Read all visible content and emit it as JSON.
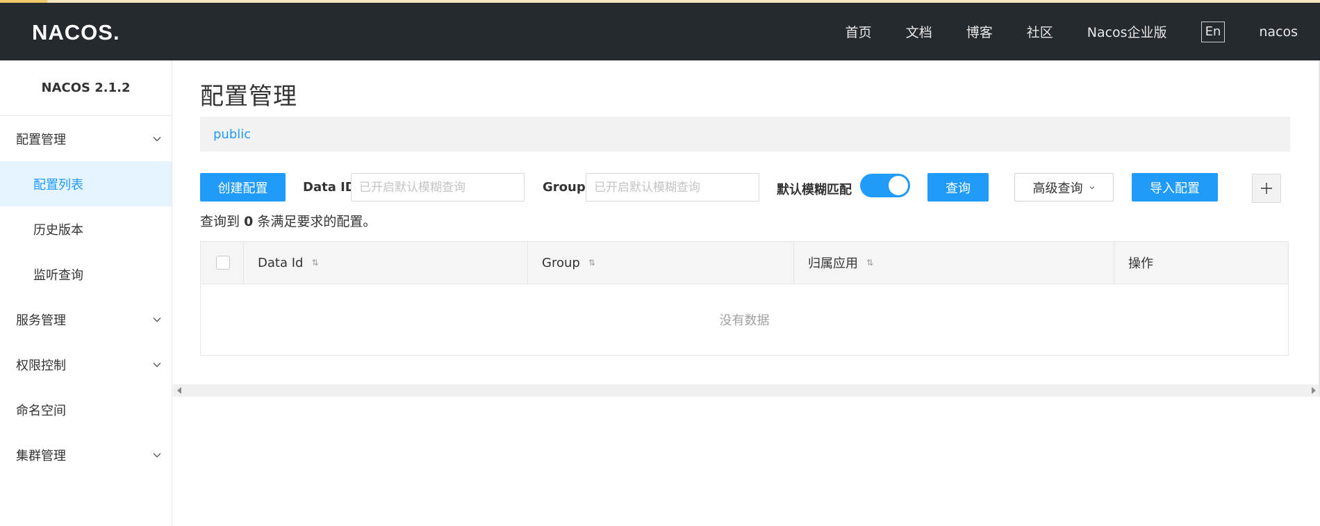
{
  "header": {
    "logo_text": "NACOS.",
    "nav": [
      "首页",
      "文档",
      "博客",
      "社区",
      "Nacos企业版"
    ],
    "lang": "En",
    "user": "nacos"
  },
  "sidebar": {
    "title": "NACOS 2.1.2",
    "groups": [
      {
        "label": "配置管理",
        "items": [
          "配置列表",
          "历史版本",
          "监听查询"
        ]
      },
      {
        "label": "服务管理"
      },
      {
        "label": "权限控制"
      },
      {
        "label": "命名空间"
      },
      {
        "label": "集群管理"
      }
    ]
  },
  "main": {
    "title": "配置管理",
    "namespace": "public",
    "toolbar": {
      "create_label": "创建配置",
      "data_id_label": "Data ID",
      "data_id_placeholder": "已开启默认模糊查询",
      "group_label": "Group",
      "group_placeholder": "已开启默认模糊查询",
      "fuzzy_label": "默认模糊匹配",
      "fuzzy_on": true,
      "query_label": "查询",
      "advanced_label": "高级查询",
      "import_label": "导入配置",
      "plus_label": "+"
    },
    "result": {
      "prefix": "查询到",
      "count": "0",
      "suffix": "条满足要求的配置。"
    },
    "table": {
      "columns": [
        "Data Id",
        "Group",
        "归属应用",
        "操作"
      ],
      "empty_text": "没有数据"
    }
  },
  "colors": {
    "header_bg": "#252a2f",
    "primary": "#209bfa",
    "active_menu_bg": "#e5f3ff"
  }
}
